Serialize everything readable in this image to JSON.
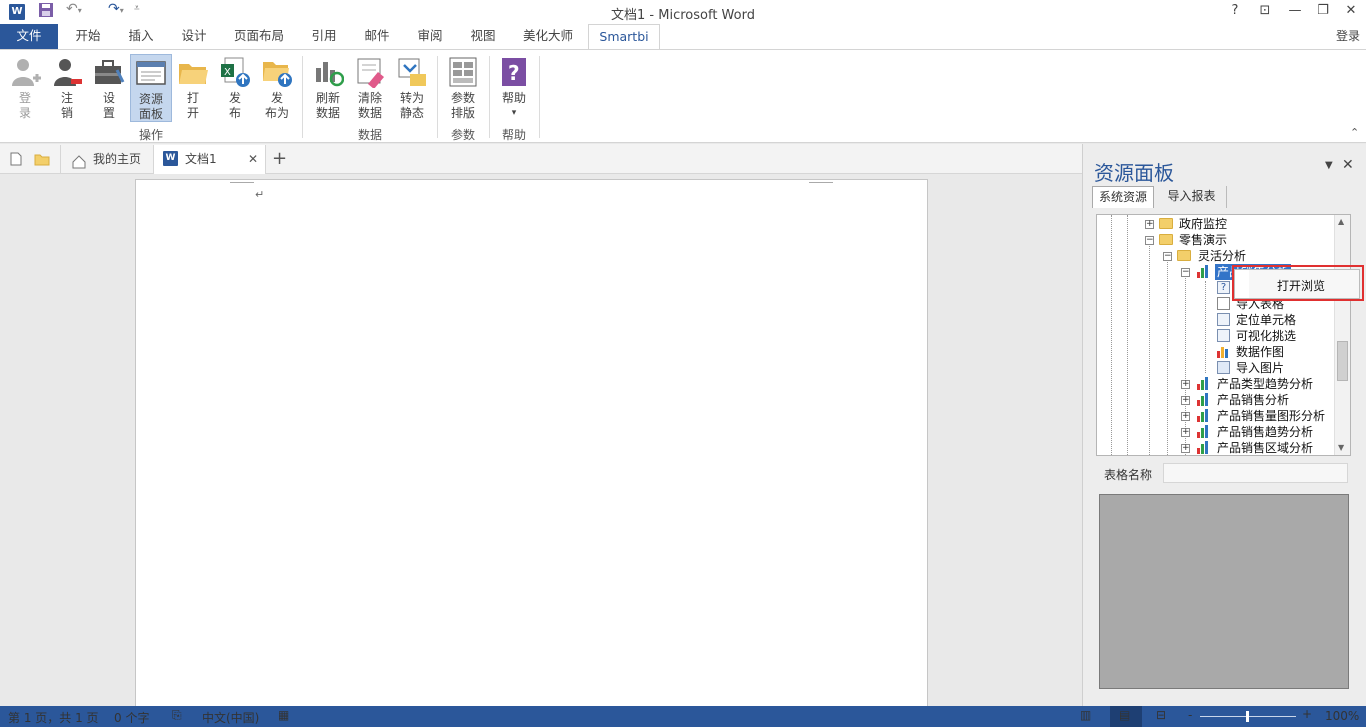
{
  "window": {
    "title": "文档1 - Microsoft Word",
    "app_icon": "word-icon"
  },
  "qat": {
    "save": "save-icon",
    "undo": "undo-icon",
    "redo": "redo-icon"
  },
  "window_controls": {
    "help": "?",
    "restore_label": "□",
    "minimize": "—",
    "maximize": "□",
    "close": "✕",
    "login": "登录"
  },
  "tabs": [
    "文件",
    "开始",
    "插入",
    "设计",
    "页面布局",
    "引用",
    "邮件",
    "审阅",
    "视图",
    "美化大师",
    "Smartbi"
  ],
  "ribbon": {
    "login": {
      "l1": "登",
      "l2": "录"
    },
    "logout": {
      "l1": "注",
      "l2": "销"
    },
    "settings": {
      "l1": "设",
      "l2": "置"
    },
    "resource_panel": {
      "l1": "资源",
      "l2": "面板"
    },
    "open": {
      "l1": "打",
      "l2": "开"
    },
    "publish": {
      "l1": "发",
      "l2": "布"
    },
    "publish_as": {
      "l1": "发",
      "l2": "布为"
    },
    "refresh": {
      "l1": "刷新",
      "l2": "数据"
    },
    "clear": {
      "l1": "清除",
      "l2": "数据"
    },
    "to_static": {
      "l1": "转为",
      "l2": "静态"
    },
    "param_layout": {
      "l1": "参数",
      "l2": "排版"
    },
    "help": {
      "l1": "帮助",
      "l2": "▾"
    },
    "groups": {
      "ops": "操作",
      "data": "数据",
      "params": "参数",
      "help": "帮助"
    }
  },
  "doc_tabs": {
    "home": "我的主页",
    "doc": "文档1",
    "close": "✕",
    "add": "+"
  },
  "document": {
    "para_mark": "↵"
  },
  "pane": {
    "title": "资源面板",
    "tab_system": "系统资源",
    "tab_import": "导入报表",
    "table_name_label": "表格名称",
    "table_name_value": "",
    "tree": [
      "政府监控",
      "零售演示",
      "灵活分析",
      "产品销售分析",
      "导入表格",
      "定位单元格",
      "可视化挑选",
      "数据作图",
      "导入图片",
      "产品类型趋势分析",
      "产品销售分析",
      "产品销售量图形分析",
      "产品销售趋势分析",
      "产品销售区域分析"
    ],
    "context_menu": {
      "open_browse": "打开浏览"
    }
  },
  "status": {
    "page": "第 1 页，共 1 页",
    "words": "0 个字",
    "language": "中文(中国)",
    "zoom": "100%",
    "zoom_minus": "-",
    "zoom_plus": "+"
  },
  "colors": {
    "accent": "#2b579a",
    "context_highlight": "#e03030"
  }
}
